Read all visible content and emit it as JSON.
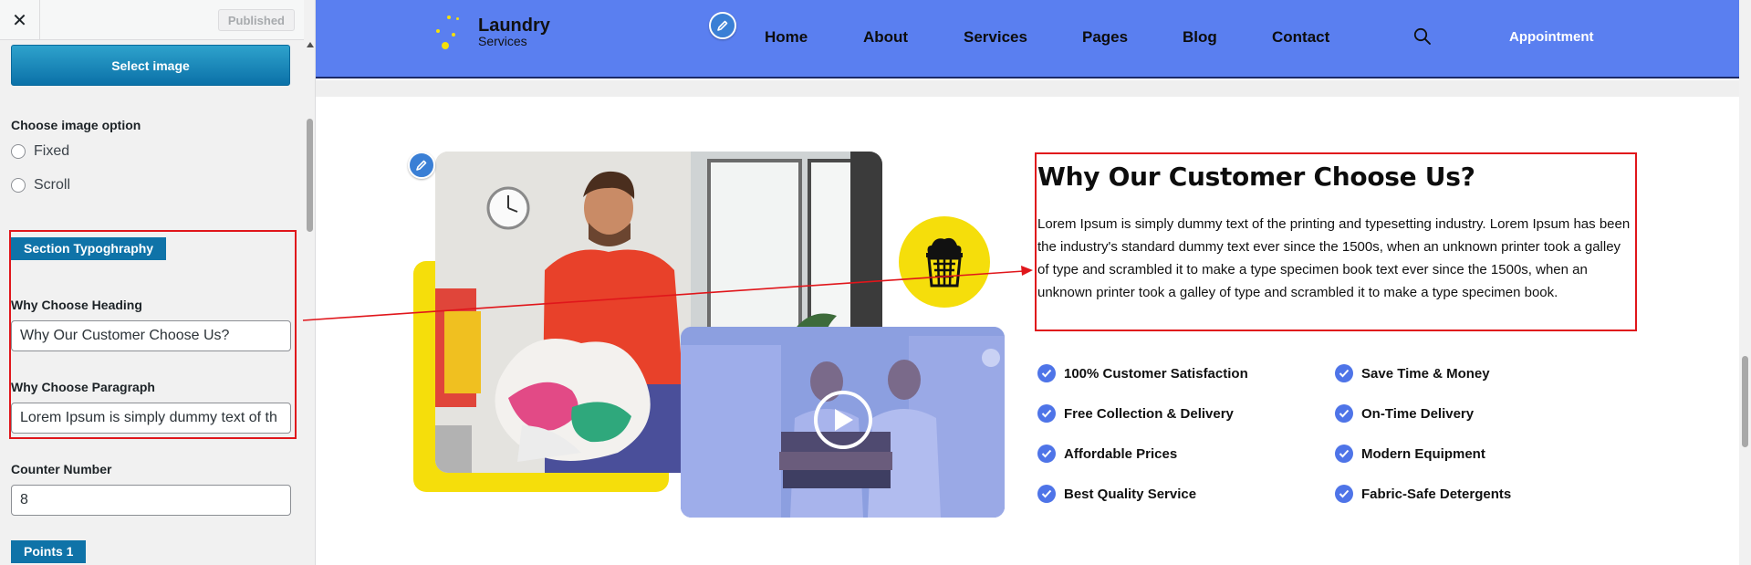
{
  "sidebar": {
    "close_label": "✕",
    "published_label": "Published",
    "select_image_label": "Select image",
    "image_option": {
      "title": "Choose image option",
      "options": [
        "Fixed",
        "Scroll"
      ]
    },
    "section_typography_label": "Section Typoghraphy",
    "heading_field": {
      "label": "Why Choose Heading",
      "value": "Why Our Customer Choose Us?"
    },
    "paragraph_field": {
      "label": "Why Choose Paragraph",
      "value": "Lorem Ipsum is simply dummy text of th"
    },
    "counter_field": {
      "label": "Counter Number",
      "value": "8"
    },
    "points_label": "Points 1"
  },
  "site": {
    "logo": {
      "name": "Laundry",
      "sub": "Services"
    },
    "nav": [
      "Home",
      "About",
      "Services",
      "Pages",
      "Blog",
      "Contact"
    ],
    "appointment_label": "Appointment",
    "why": {
      "heading": "Why Our Customer Choose Us?",
      "paragraph": "Lorem Ipsum is simply dummy text of the printing and typesetting industry. Lorem Ipsum has been the industry's standard dummy text ever since the 1500s, when an unknown printer took a galley of type and scrambled it to make a type specimen book text ever since the 1500s, when an unknown printer took a galley of type and scrambled it to make a type specimen book."
    },
    "points": [
      "100% Customer Satisfaction",
      "Save Time & Money",
      "Free Collection & Delivery",
      "On-Time Delivery",
      "Affordable Prices",
      "Modern Equipment",
      "Best Quality Service",
      "Fabric-Safe Detergents"
    ]
  },
  "colors": {
    "header": "#5a7ff0",
    "accent_yellow": "#f5de0b",
    "highlight_red": "#e0161b",
    "check_blue": "#4e74e8"
  }
}
